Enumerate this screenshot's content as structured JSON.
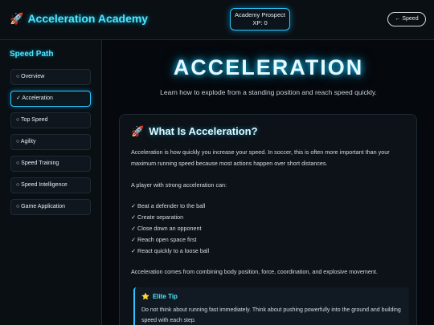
{
  "header": {
    "brand_icon": "🚀",
    "brand_title": "Acceleration Academy",
    "rank": "Academy Prospect",
    "xp": "XP: 0",
    "back_button": "← Speed"
  },
  "sidebar": {
    "title": "Speed Path",
    "items": [
      {
        "label": "○ Overview",
        "active": false
      },
      {
        "label": "✓ Acceleration",
        "active": true
      },
      {
        "label": "○ Top Speed",
        "active": false
      },
      {
        "label": "○ Agility",
        "active": false
      },
      {
        "label": "○ Speed Training",
        "active": false
      },
      {
        "label": "○ Speed Intelligence",
        "active": false
      },
      {
        "label": "○ Game Application",
        "active": false
      }
    ]
  },
  "main": {
    "title": "ACCELERATION",
    "subtitle": "Learn how to explode from a standing position and reach speed quickly.",
    "section": {
      "icon": "🚀",
      "title": "What Is Acceleration?",
      "intro": "Acceleration is how quickly you increase your speed. In soccer, this is often more important than your maximum running speed because most actions happen over short distances.",
      "list_intro": "A player with strong acceleration can:",
      "checklist": [
        "✓ Beat a defender to the ball",
        "✓ Create separation",
        "✓ Close down an opponent",
        "✓ Reach open space first",
        "✓ React quickly to a loose ball"
      ],
      "summary": "Acceleration comes from combining body position, force, coordination, and explosive movement.",
      "tip": {
        "icon": "⭐",
        "title": "Elite Tip",
        "text": "Do not think about running fast immediately. Think about pushing powerfully into the ground and building speed with each step."
      }
    }
  },
  "colors": {
    "accent": "#4fe6ff",
    "background": "#05080c",
    "panel": "#0a0f14"
  }
}
